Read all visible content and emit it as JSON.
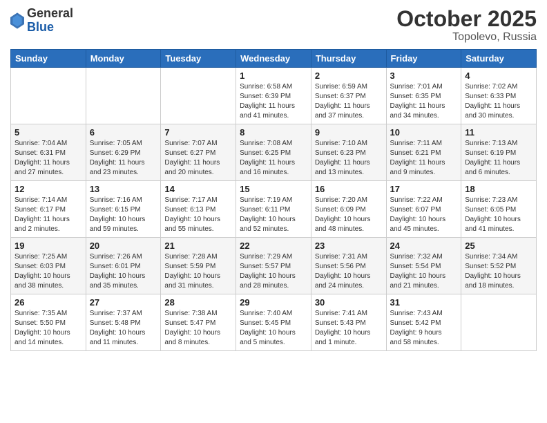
{
  "header": {
    "logo_general": "General",
    "logo_blue": "Blue",
    "month": "October 2025",
    "location": "Topolevo, Russia"
  },
  "weekdays": [
    "Sunday",
    "Monday",
    "Tuesday",
    "Wednesday",
    "Thursday",
    "Friday",
    "Saturday"
  ],
  "weeks": [
    [
      {
        "day": "",
        "info": ""
      },
      {
        "day": "",
        "info": ""
      },
      {
        "day": "",
        "info": ""
      },
      {
        "day": "1",
        "info": "Sunrise: 6:58 AM\nSunset: 6:39 PM\nDaylight: 11 hours\nand 41 minutes."
      },
      {
        "day": "2",
        "info": "Sunrise: 6:59 AM\nSunset: 6:37 PM\nDaylight: 11 hours\nand 37 minutes."
      },
      {
        "day": "3",
        "info": "Sunrise: 7:01 AM\nSunset: 6:35 PM\nDaylight: 11 hours\nand 34 minutes."
      },
      {
        "day": "4",
        "info": "Sunrise: 7:02 AM\nSunset: 6:33 PM\nDaylight: 11 hours\nand 30 minutes."
      }
    ],
    [
      {
        "day": "5",
        "info": "Sunrise: 7:04 AM\nSunset: 6:31 PM\nDaylight: 11 hours\nand 27 minutes."
      },
      {
        "day": "6",
        "info": "Sunrise: 7:05 AM\nSunset: 6:29 PM\nDaylight: 11 hours\nand 23 minutes."
      },
      {
        "day": "7",
        "info": "Sunrise: 7:07 AM\nSunset: 6:27 PM\nDaylight: 11 hours\nand 20 minutes."
      },
      {
        "day": "8",
        "info": "Sunrise: 7:08 AM\nSunset: 6:25 PM\nDaylight: 11 hours\nand 16 minutes."
      },
      {
        "day": "9",
        "info": "Sunrise: 7:10 AM\nSunset: 6:23 PM\nDaylight: 11 hours\nand 13 minutes."
      },
      {
        "day": "10",
        "info": "Sunrise: 7:11 AM\nSunset: 6:21 PM\nDaylight: 11 hours\nand 9 minutes."
      },
      {
        "day": "11",
        "info": "Sunrise: 7:13 AM\nSunset: 6:19 PM\nDaylight: 11 hours\nand 6 minutes."
      }
    ],
    [
      {
        "day": "12",
        "info": "Sunrise: 7:14 AM\nSunset: 6:17 PM\nDaylight: 11 hours\nand 2 minutes."
      },
      {
        "day": "13",
        "info": "Sunrise: 7:16 AM\nSunset: 6:15 PM\nDaylight: 10 hours\nand 59 minutes."
      },
      {
        "day": "14",
        "info": "Sunrise: 7:17 AM\nSunset: 6:13 PM\nDaylight: 10 hours\nand 55 minutes."
      },
      {
        "day": "15",
        "info": "Sunrise: 7:19 AM\nSunset: 6:11 PM\nDaylight: 10 hours\nand 52 minutes."
      },
      {
        "day": "16",
        "info": "Sunrise: 7:20 AM\nSunset: 6:09 PM\nDaylight: 10 hours\nand 48 minutes."
      },
      {
        "day": "17",
        "info": "Sunrise: 7:22 AM\nSunset: 6:07 PM\nDaylight: 10 hours\nand 45 minutes."
      },
      {
        "day": "18",
        "info": "Sunrise: 7:23 AM\nSunset: 6:05 PM\nDaylight: 10 hours\nand 41 minutes."
      }
    ],
    [
      {
        "day": "19",
        "info": "Sunrise: 7:25 AM\nSunset: 6:03 PM\nDaylight: 10 hours\nand 38 minutes."
      },
      {
        "day": "20",
        "info": "Sunrise: 7:26 AM\nSunset: 6:01 PM\nDaylight: 10 hours\nand 35 minutes."
      },
      {
        "day": "21",
        "info": "Sunrise: 7:28 AM\nSunset: 5:59 PM\nDaylight: 10 hours\nand 31 minutes."
      },
      {
        "day": "22",
        "info": "Sunrise: 7:29 AM\nSunset: 5:57 PM\nDaylight: 10 hours\nand 28 minutes."
      },
      {
        "day": "23",
        "info": "Sunrise: 7:31 AM\nSunset: 5:56 PM\nDaylight: 10 hours\nand 24 minutes."
      },
      {
        "day": "24",
        "info": "Sunrise: 7:32 AM\nSunset: 5:54 PM\nDaylight: 10 hours\nand 21 minutes."
      },
      {
        "day": "25",
        "info": "Sunrise: 7:34 AM\nSunset: 5:52 PM\nDaylight: 10 hours\nand 18 minutes."
      }
    ],
    [
      {
        "day": "26",
        "info": "Sunrise: 7:35 AM\nSunset: 5:50 PM\nDaylight: 10 hours\nand 14 minutes."
      },
      {
        "day": "27",
        "info": "Sunrise: 7:37 AM\nSunset: 5:48 PM\nDaylight: 10 hours\nand 11 minutes."
      },
      {
        "day": "28",
        "info": "Sunrise: 7:38 AM\nSunset: 5:47 PM\nDaylight: 10 hours\nand 8 minutes."
      },
      {
        "day": "29",
        "info": "Sunrise: 7:40 AM\nSunset: 5:45 PM\nDaylight: 10 hours\nand 5 minutes."
      },
      {
        "day": "30",
        "info": "Sunrise: 7:41 AM\nSunset: 5:43 PM\nDaylight: 10 hours\nand 1 minute."
      },
      {
        "day": "31",
        "info": "Sunrise: 7:43 AM\nSunset: 5:42 PM\nDaylight: 9 hours\nand 58 minutes."
      },
      {
        "day": "",
        "info": ""
      }
    ]
  ]
}
